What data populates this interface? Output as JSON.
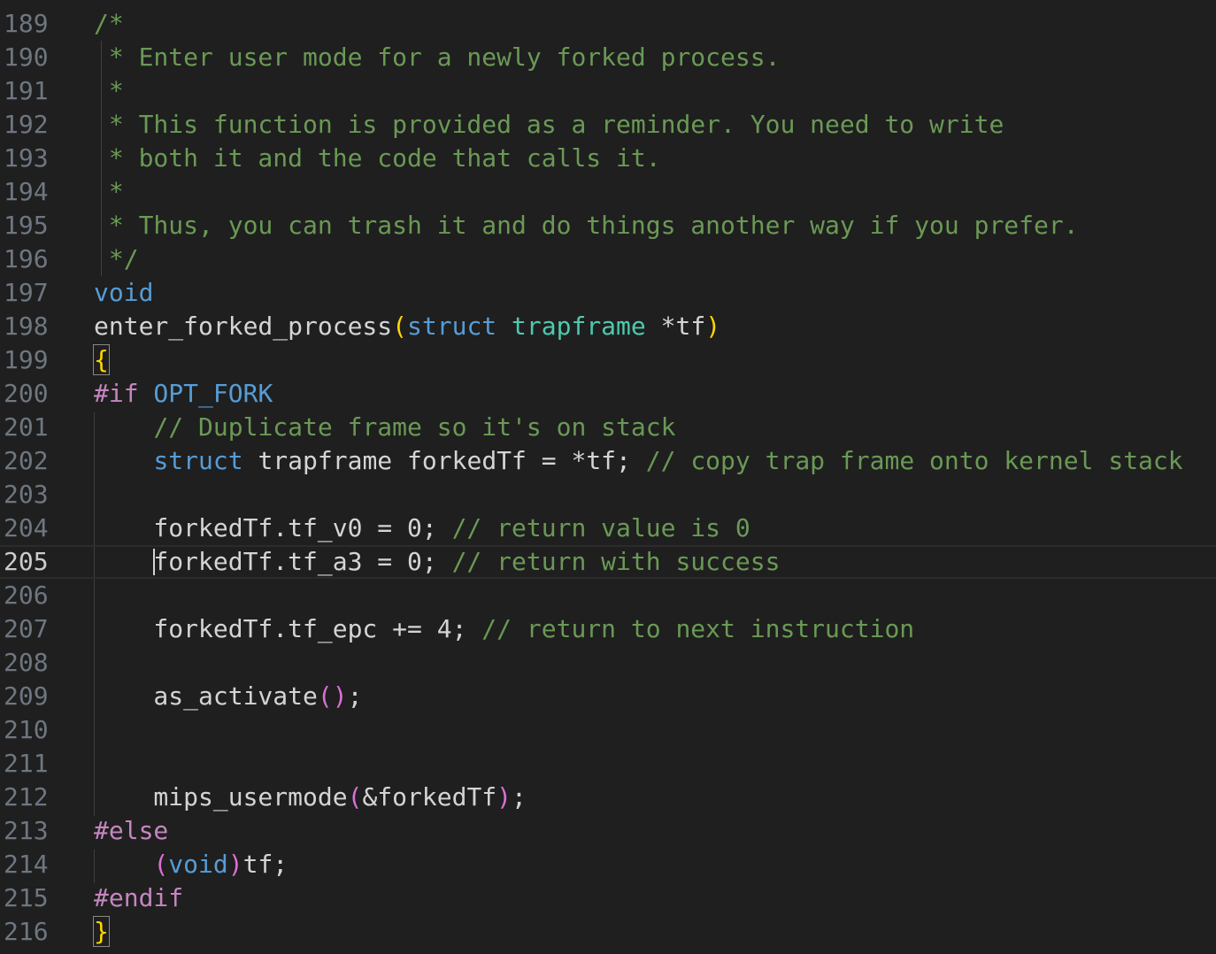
{
  "editor": {
    "language": "c",
    "theme": "dark",
    "current_line": 205,
    "lines": [
      {
        "number": "189",
        "tokens": [
          {
            "t": "/*",
            "c": "com"
          }
        ]
      },
      {
        "number": "190",
        "tokens": [
          {
            "t": " * Enter user mode for a newly forked process.",
            "c": "com"
          }
        ]
      },
      {
        "number": "191",
        "tokens": [
          {
            "t": " *",
            "c": "com"
          }
        ]
      },
      {
        "number": "192",
        "tokens": [
          {
            "t": " * This function is provided as a reminder. You need to write",
            "c": "com"
          }
        ]
      },
      {
        "number": "193",
        "tokens": [
          {
            "t": " * both it and the code that calls it.",
            "c": "com"
          }
        ]
      },
      {
        "number": "194",
        "tokens": [
          {
            "t": " *",
            "c": "com"
          }
        ]
      },
      {
        "number": "195",
        "tokens": [
          {
            "t": " * Thus, you can trash it and do things another way if you prefer.",
            "c": "com"
          }
        ]
      },
      {
        "number": "196",
        "tokens": [
          {
            "t": " */",
            "c": "com"
          }
        ]
      },
      {
        "number": "197",
        "tokens": [
          {
            "t": "void",
            "c": "kw"
          }
        ]
      },
      {
        "number": "198",
        "tokens": [
          {
            "t": "enter_forked_process",
            "c": "op"
          },
          {
            "t": "(",
            "c": "br1"
          },
          {
            "t": "struct",
            "c": "kw"
          },
          {
            "t": " ",
            "c": "op"
          },
          {
            "t": "trapframe",
            "c": "type"
          },
          {
            "t": " *tf",
            "c": "op"
          },
          {
            "t": ")",
            "c": "br1"
          }
        ]
      },
      {
        "number": "199",
        "tokens": [
          {
            "t": "{",
            "c": "br1box"
          }
        ]
      },
      {
        "number": "200",
        "tokens": [
          {
            "t": "#if",
            "c": "pre"
          },
          {
            "t": " OPT_FORK",
            "c": "macro"
          }
        ]
      },
      {
        "number": "201",
        "tokens": [
          {
            "t": "    ",
            "c": "op"
          },
          {
            "t": "// Duplicate frame so it's on stack",
            "c": "com"
          }
        ]
      },
      {
        "number": "202",
        "tokens": [
          {
            "t": "    ",
            "c": "op"
          },
          {
            "t": "struct",
            "c": "kw"
          },
          {
            "t": " trapframe forkedTf = *tf; ",
            "c": "op"
          },
          {
            "t": "// copy trap frame onto kernel stack",
            "c": "com"
          }
        ]
      },
      {
        "number": "203",
        "tokens": []
      },
      {
        "number": "204",
        "tokens": [
          {
            "t": "    forkedTf.tf_v0 = 0; ",
            "c": "op"
          },
          {
            "t": "// return value is 0",
            "c": "com"
          }
        ]
      },
      {
        "number": "205",
        "tokens": [
          {
            "t": "    forkedTf.tf_a3 = 0; ",
            "c": "op"
          },
          {
            "t": "// return with success",
            "c": "com"
          }
        ]
      },
      {
        "number": "206",
        "tokens": []
      },
      {
        "number": "207",
        "tokens": [
          {
            "t": "    forkedTf.tf_epc += 4; ",
            "c": "op"
          },
          {
            "t": "// return to next instruction",
            "c": "com"
          }
        ]
      },
      {
        "number": "208",
        "tokens": []
      },
      {
        "number": "209",
        "tokens": [
          {
            "t": "    as_activate",
            "c": "op"
          },
          {
            "t": "()",
            "c": "br2"
          },
          {
            "t": ";",
            "c": "op"
          }
        ]
      },
      {
        "number": "210",
        "tokens": []
      },
      {
        "number": "211",
        "tokens": []
      },
      {
        "number": "212",
        "tokens": [
          {
            "t": "    mips_usermode",
            "c": "op"
          },
          {
            "t": "(",
            "c": "br2"
          },
          {
            "t": "&forkedTf",
            "c": "op"
          },
          {
            "t": ")",
            "c": "br2"
          },
          {
            "t": ";",
            "c": "op"
          }
        ]
      },
      {
        "number": "213",
        "tokens": [
          {
            "t": "#else",
            "c": "pre"
          }
        ]
      },
      {
        "number": "214",
        "tokens": [
          {
            "t": "    ",
            "c": "op"
          },
          {
            "t": "(",
            "c": "br2"
          },
          {
            "t": "void",
            "c": "kw"
          },
          {
            "t": ")",
            "c": "br2"
          },
          {
            "t": "tf;",
            "c": "op"
          }
        ]
      },
      {
        "number": "215",
        "tokens": [
          {
            "t": "#endif",
            "c": "pre"
          }
        ]
      },
      {
        "number": "216",
        "tokens": [
          {
            "t": "}",
            "c": "br1box"
          }
        ]
      }
    ]
  },
  "colors": {
    "background": "#1f1f1f",
    "comment": "#6a9955",
    "keyword": "#569cd6",
    "type": "#4ec9b0",
    "text": "#d4d4d4",
    "bracket_level1": "#ffd700",
    "bracket_level2": "#da70d6",
    "preprocessor": "#c586c0",
    "line_number": "#6e7681",
    "line_number_active": "#cccccc"
  }
}
